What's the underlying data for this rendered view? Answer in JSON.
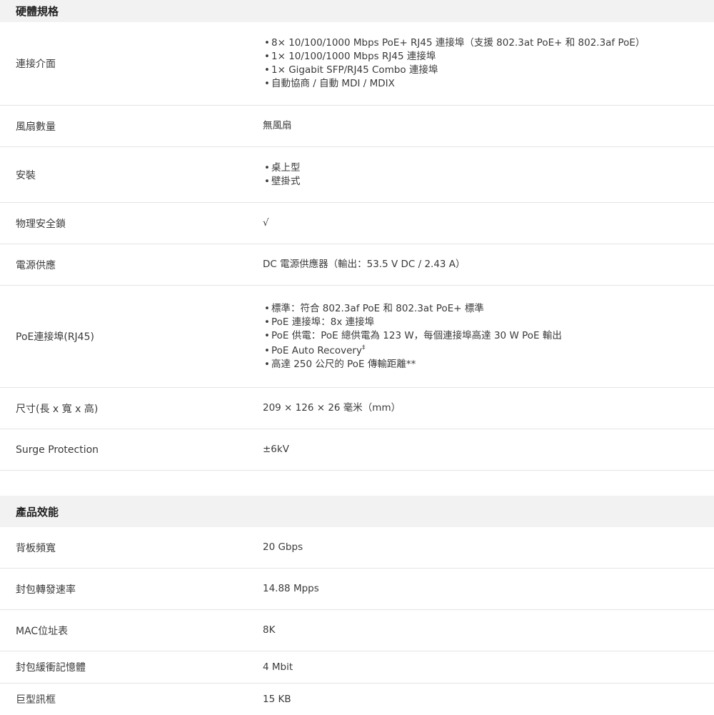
{
  "hardware": {
    "title": "硬體規格",
    "rows": [
      {
        "label": "連接介面",
        "items": [
          "8× 10/100/1000 Mbps PoE+ RJ45 連接埠（支援 802.3at PoE+ 和 802.3af PoE）",
          "1× 10/100/1000 Mbps RJ45 連接埠",
          "1× Gigabit SFP/RJ45 Combo 連接埠",
          "自動協商 / 自動 MDI / MDIX"
        ]
      },
      {
        "label": "風扇數量",
        "value": "無風扇"
      },
      {
        "label": "安裝",
        "items": [
          "桌上型",
          "壁掛式"
        ]
      },
      {
        "label": "物理安全鎖",
        "value": "√"
      },
      {
        "label": "電源供應",
        "value": "DC 電源供應器（輸出：53.5 V DC / 2.43 A）"
      },
      {
        "label": "PoE連接埠(RJ45)",
        "items": [
          "標準：符合 802.3af PoE 和 802.3at PoE+ 標準",
          "PoE 連接埠：8x 連接埠",
          "PoE 供電：PoE 總供電為 123 W，每個連接埠高達 30 W PoE 輸出",
          "PoE Auto Recovery",
          "高達 250 公尺的 PoE 傳輸距離**"
        ],
        "footnote": "‡"
      },
      {
        "label": "尺寸(長 x 寬 x 高)",
        "value": "209 × 126 × 26 毫米（mm）"
      },
      {
        "label": "Surge Protection",
        "value": "±6kV"
      }
    ]
  },
  "performance": {
    "title": "產品效能",
    "rows": [
      {
        "label": "背板頻寬",
        "value": "20 Gbps"
      },
      {
        "label": "封包轉發速率",
        "value": "14.88 Mpps"
      },
      {
        "label": "MAC位址表",
        "value": "8K"
      },
      {
        "label": "封包緩衝記憶體",
        "value": "4 Mbit"
      },
      {
        "label": "巨型訊框",
        "value": "15 KB"
      }
    ]
  }
}
